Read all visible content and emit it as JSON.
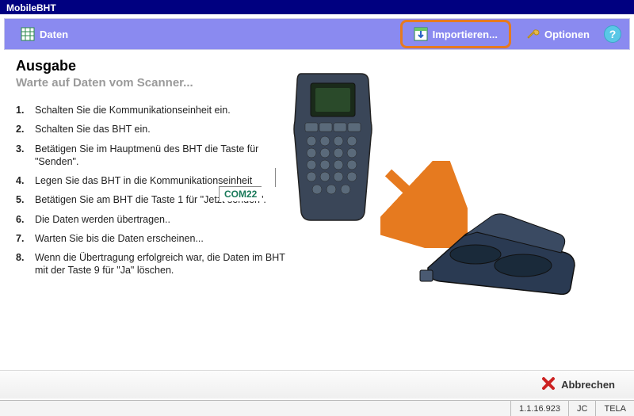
{
  "titlebar": {
    "title": "MobileBHT"
  },
  "toolbar": {
    "daten": "Daten",
    "importieren": "Importieren...",
    "optionen": "Optionen"
  },
  "content": {
    "heading": "Ausgabe",
    "subheading": "Warte auf Daten vom Scanner...",
    "com_label": "COM22",
    "steps": [
      "Schalten Sie die Kommunikationseinheit ein.",
      "Schalten Sie das BHT ein.",
      "Betätigen Sie im Hauptmenü des BHT die Taste für \"Senden\".",
      "Legen Sie das BHT in die Kommunikationseinheit",
      "Betätigen Sie am BHT die Taste 1 für \"Jetzt senden\".",
      "Die Daten werden übertragen..",
      "Warten Sie bis die Daten erscheinen...",
      "Wenn die Übertragung erfolgreich war, die Daten im BHT mit der Taste 9 für \"Ja\" löschen."
    ]
  },
  "footer": {
    "cancel": "Abbrechen"
  },
  "statusbar": {
    "version": "1.1.16.923",
    "user": "JC",
    "db": "TELA"
  }
}
